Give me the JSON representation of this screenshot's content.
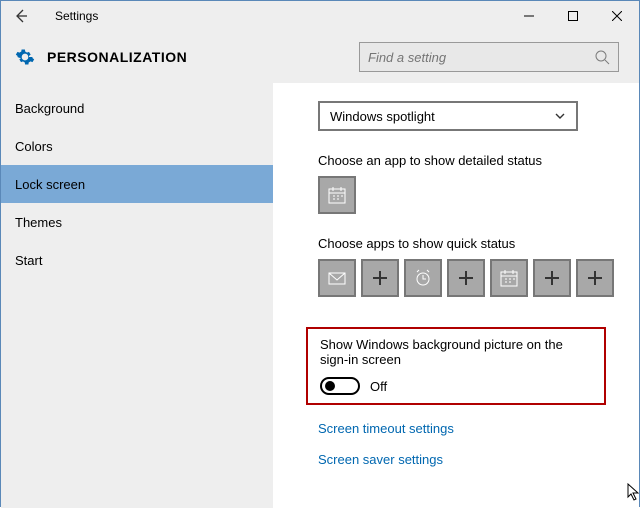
{
  "titlebar": {
    "title": "Settings"
  },
  "header": {
    "page_title": "PERSONALIZATION",
    "search_placeholder": "Find a setting"
  },
  "sidebar": {
    "items": [
      {
        "label": "Background",
        "selected": false
      },
      {
        "label": "Colors",
        "selected": false
      },
      {
        "label": "Lock screen",
        "selected": true
      },
      {
        "label": "Themes",
        "selected": false
      },
      {
        "label": "Start",
        "selected": false
      }
    ]
  },
  "content": {
    "dropdown_value": "Windows spotlight",
    "detail_label": "Choose an app to show detailed status",
    "quick_label": "Choose apps to show quick status",
    "toggle_label": "Show Windows background picture on the sign-in screen",
    "toggle_state": "Off",
    "link_timeout": "Screen timeout settings",
    "link_saver": "Screen saver settings"
  }
}
